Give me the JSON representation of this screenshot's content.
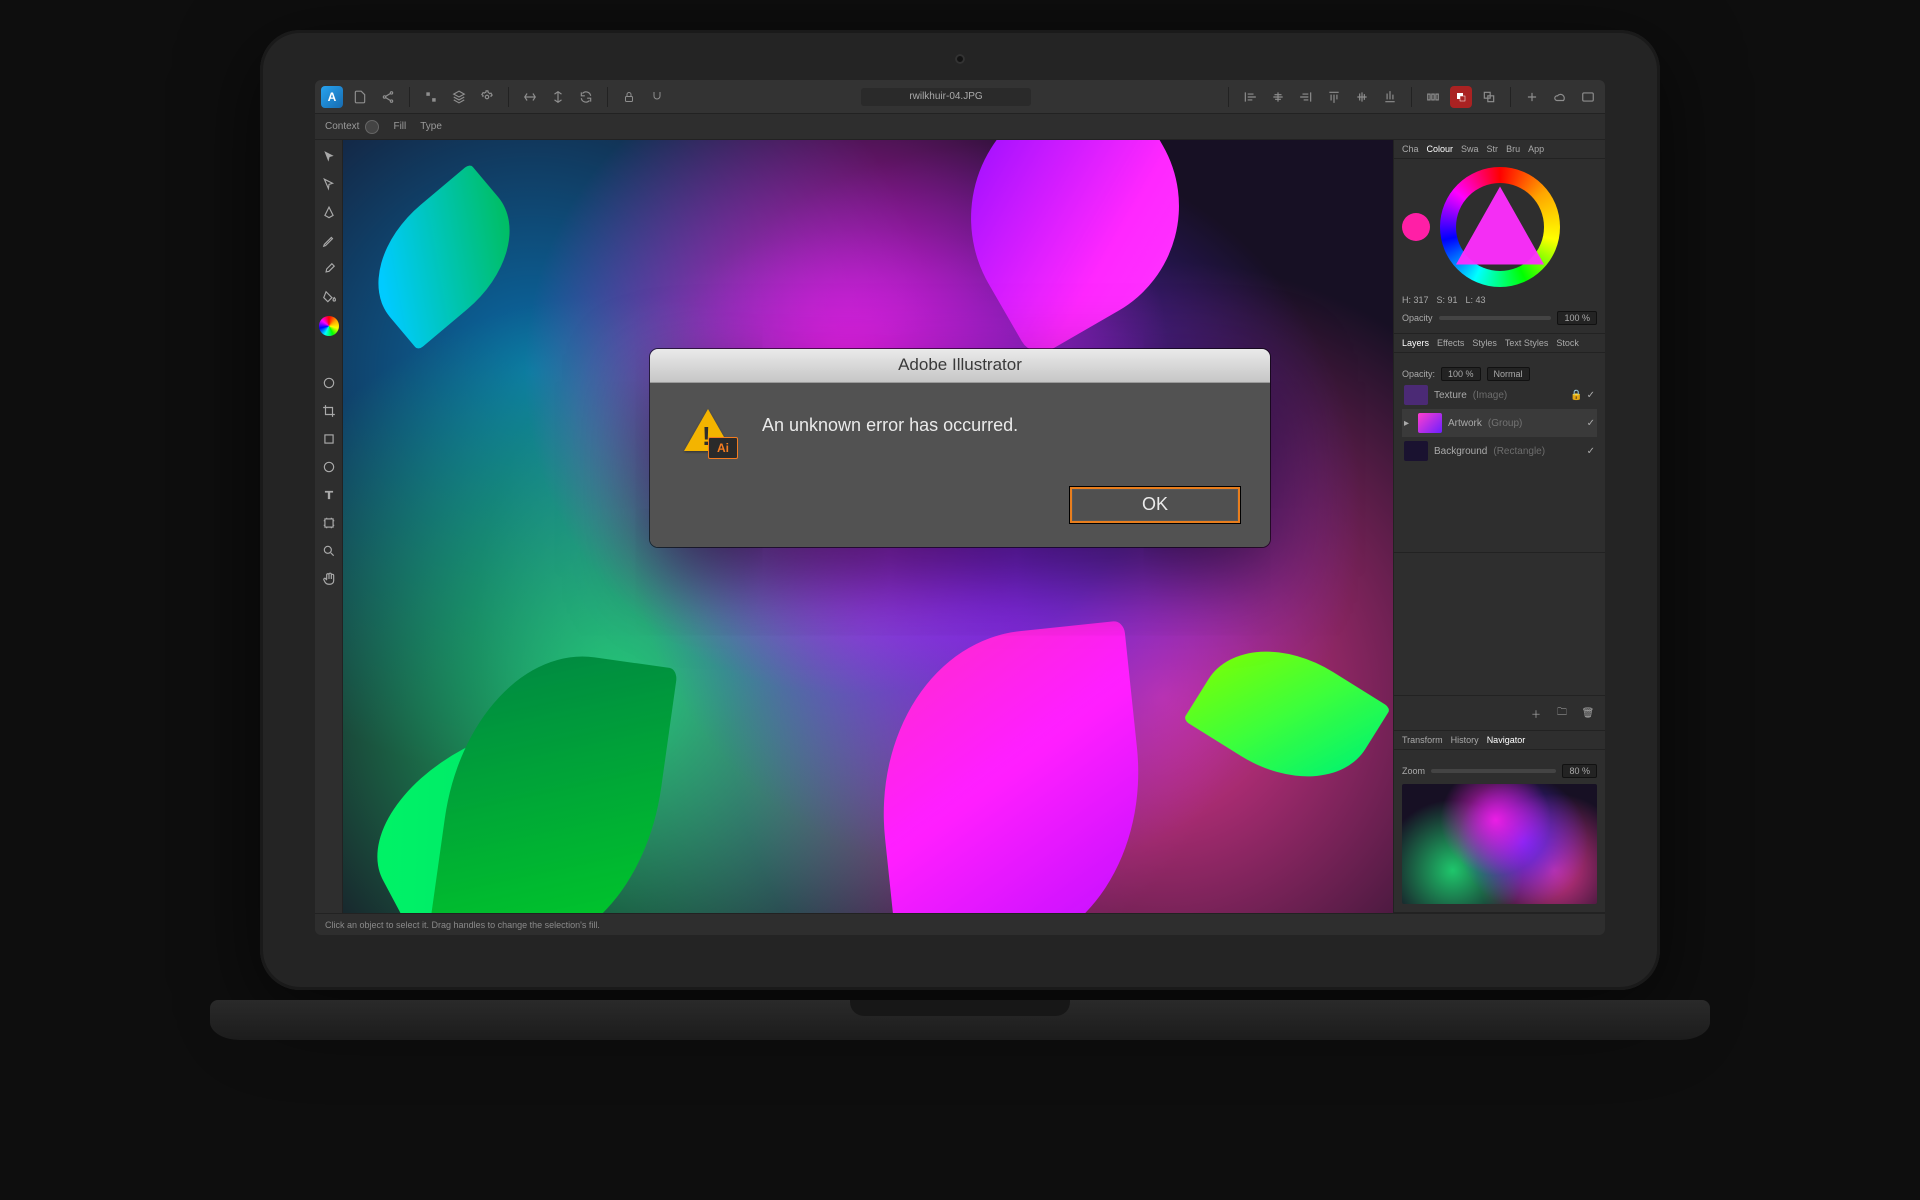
{
  "dialog": {
    "title": "Adobe Illustrator",
    "message": "An unknown error has occurred.",
    "icon_badge": "Ai",
    "ok_label": "OK"
  },
  "document": {
    "title": "rwilkhuir-04.JPG"
  },
  "contextbar": {
    "context_label": "Context",
    "fill_label": "Fill",
    "type_label": "Type"
  },
  "color_panel": {
    "tabs": [
      "Cha",
      "Colour",
      "Swa",
      "Str",
      "Bru",
      "App"
    ],
    "h": "H: 317",
    "s": "S: 91",
    "l": "L: 43",
    "opacity_label": "Opacity",
    "opacity_value": "100 %"
  },
  "layers_panel": {
    "tabs": [
      "Layers",
      "Effects",
      "Styles",
      "Text Styles",
      "Stock"
    ],
    "opacity_label": "Opacity:",
    "opacity_value": "100 %",
    "blend_value": "Normal",
    "items": [
      {
        "name": "Texture",
        "type": "(Image)"
      },
      {
        "name": "Artwork",
        "type": "(Group)"
      },
      {
        "name": "Background",
        "type": "(Rectangle)"
      }
    ]
  },
  "navigator_panel": {
    "tabs": [
      "Transform",
      "History",
      "Navigator"
    ],
    "zoom_label": "Zoom",
    "zoom_value": "80 %"
  },
  "statusbar": {
    "hint": "Click an object to select it. Drag handles to change the selection's fill."
  },
  "tool_rail": {
    "tools": [
      "move-tool",
      "node-tool",
      "pen-tool",
      "pencil-tool",
      "brush-tool",
      "fill-tool",
      "gradient-tool",
      "transparency-tool",
      "color-picker-tool",
      "crop-tool",
      "shape-tool",
      "text-tool",
      "artboard-tool",
      "zoom-tool"
    ]
  },
  "toolbar": {
    "logo_label": "A"
  }
}
